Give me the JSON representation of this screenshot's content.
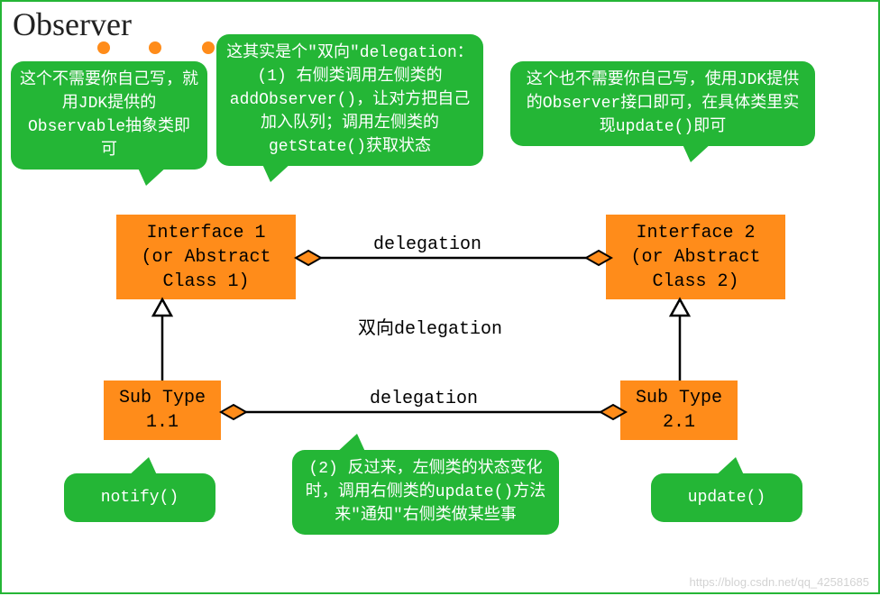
{
  "title": "Observer",
  "callouts": {
    "left": "这个不需要你自己写，就用JDK提供的Observable抽象类即可",
    "center_top": "这其实是个\"双向\"delegation：(1) 右侧类调用左侧类的addObserver()，让对方把自己加入队列；调用左侧类的getState()获取状态",
    "right": "这个也不需要你自己写，使用JDK提供的Observer接口即可，在具体类里实现update()即可",
    "bottom": "(2) 反过来，左侧类的状态变化时，调用右侧类的update()方法来\"通知\"右侧类做某些事",
    "notify": "notify()",
    "update": "update()"
  },
  "boxes": {
    "interface1": "Interface 1\n(or Abstract\nClass 1)",
    "interface2": "Interface 2\n(or Abstract\nClass 2)",
    "sub1": "Sub Type\n1.1",
    "sub2": "Sub Type\n2.1"
  },
  "labels": {
    "delegation_top": "delegation",
    "delegation_mid": "双向delegation",
    "delegation_bottom": "delegation"
  },
  "watermark": "https://blog.csdn.net/qq_42581685",
  "chart_data": {
    "type": "diagram",
    "pattern": "Observer",
    "nodes": [
      {
        "id": "interface1",
        "label": "Interface 1 (or Abstract Class 1)",
        "note": "Observable"
      },
      {
        "id": "interface2",
        "label": "Interface 2 (or Abstract Class 2)",
        "note": "Observer"
      },
      {
        "id": "sub1",
        "label": "Sub Type 1.1",
        "method": "notify()"
      },
      {
        "id": "sub2",
        "label": "Sub Type 2.1",
        "method": "update()"
      }
    ],
    "edges": [
      {
        "from": "interface1",
        "to": "interface2",
        "type": "aggregation/delegation",
        "direction": "bidirectional",
        "label": "delegation"
      },
      {
        "from": "sub1",
        "to": "interface1",
        "type": "inheritance"
      },
      {
        "from": "sub2",
        "to": "interface2",
        "type": "inheritance"
      },
      {
        "from": "sub1",
        "to": "sub2",
        "type": "aggregation/delegation",
        "direction": "bidirectional",
        "label": "delegation"
      }
    ]
  }
}
